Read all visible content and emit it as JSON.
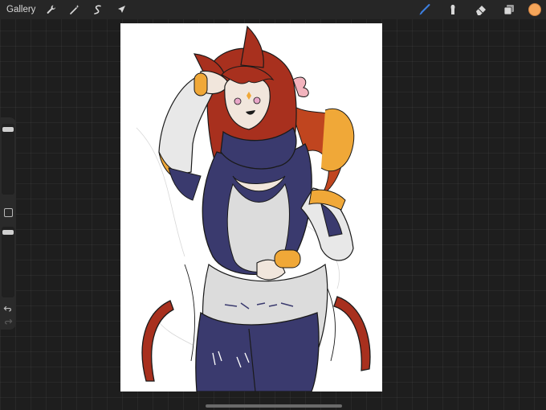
{
  "topbar": {
    "gallery_label": "Gallery",
    "left_tools": [
      "wrench-icon",
      "magic-wand-icon",
      "selection-icon",
      "transform-arrow-icon"
    ],
    "right_tools": [
      "brush-icon",
      "smudge-icon",
      "eraser-icon",
      "layers-icon"
    ],
    "active_tool": "brush-icon",
    "active_tool_color": "#3d7fe0",
    "current_color": "#f6a65a"
  },
  "sidebar": {
    "brush_size_slider": "brush-size-slider",
    "opacity_slider": "opacity-slider",
    "undo_icon": "undo-icon",
    "redo_icon": "redo-icon"
  },
  "canvas": {
    "background_color": "#ffffff",
    "artwork_palette": {
      "hair": "#a8301e",
      "outfit": "#3a3a6e",
      "dress": "#dcdcdc",
      "skin": "#f1e6dc",
      "accent": "#f0a838"
    }
  }
}
